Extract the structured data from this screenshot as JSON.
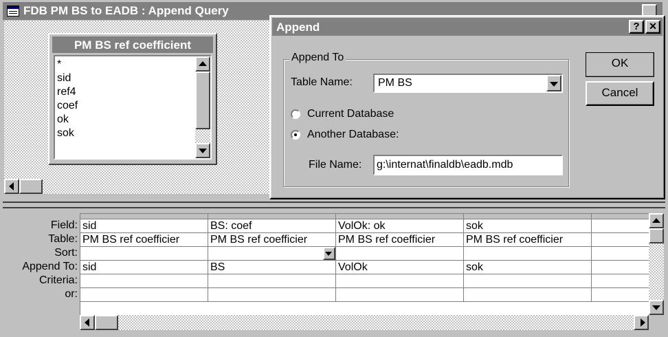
{
  "main_window": {
    "title": "FDB PM BS to EADB : Append Query"
  },
  "field_list": {
    "title": "PM BS ref coefficient",
    "items": [
      "*",
      "sid",
      "ref4",
      "coef",
      "ok",
      "sok"
    ]
  },
  "dialog": {
    "title": "Append",
    "help_label": "?",
    "close_label": "×",
    "group_label": "Append To",
    "table_name_label": "Table Name:",
    "table_name_value": "PM BS",
    "current_db_label": "Current Database",
    "another_db_label": "Another Database:",
    "file_name_label": "File Name:",
    "file_name_value": "g:\\internat\\finaldb\\eadb.mdb",
    "selected_option": "another",
    "ok_label": "OK",
    "cancel_label": "Cancel"
  },
  "grid": {
    "row_labels": [
      "Field:",
      "Table:",
      "Sort:",
      "Append To:",
      "Criteria:",
      "or:"
    ],
    "columns": [
      {
        "field": "sid",
        "table": "PM BS ref coefficier",
        "sort": "",
        "append_to": "sid",
        "criteria": "",
        "or": ""
      },
      {
        "field": "BS: coef",
        "table": "PM BS ref coefficier",
        "sort": "",
        "append_to": "BS",
        "criteria": "",
        "or": ""
      },
      {
        "field": "VolOk: ok",
        "table": "PM BS ref coefficier",
        "sort": "",
        "append_to": "VolOk",
        "criteria": "",
        "or": ""
      },
      {
        "field": "sok",
        "table": "PM BS ref coefficier",
        "sort": "",
        "append_to": "sok",
        "criteria": "",
        "or": ""
      },
      {
        "field": "",
        "table": "",
        "sort": "",
        "append_to": "",
        "criteria": "",
        "or": ""
      }
    ]
  }
}
